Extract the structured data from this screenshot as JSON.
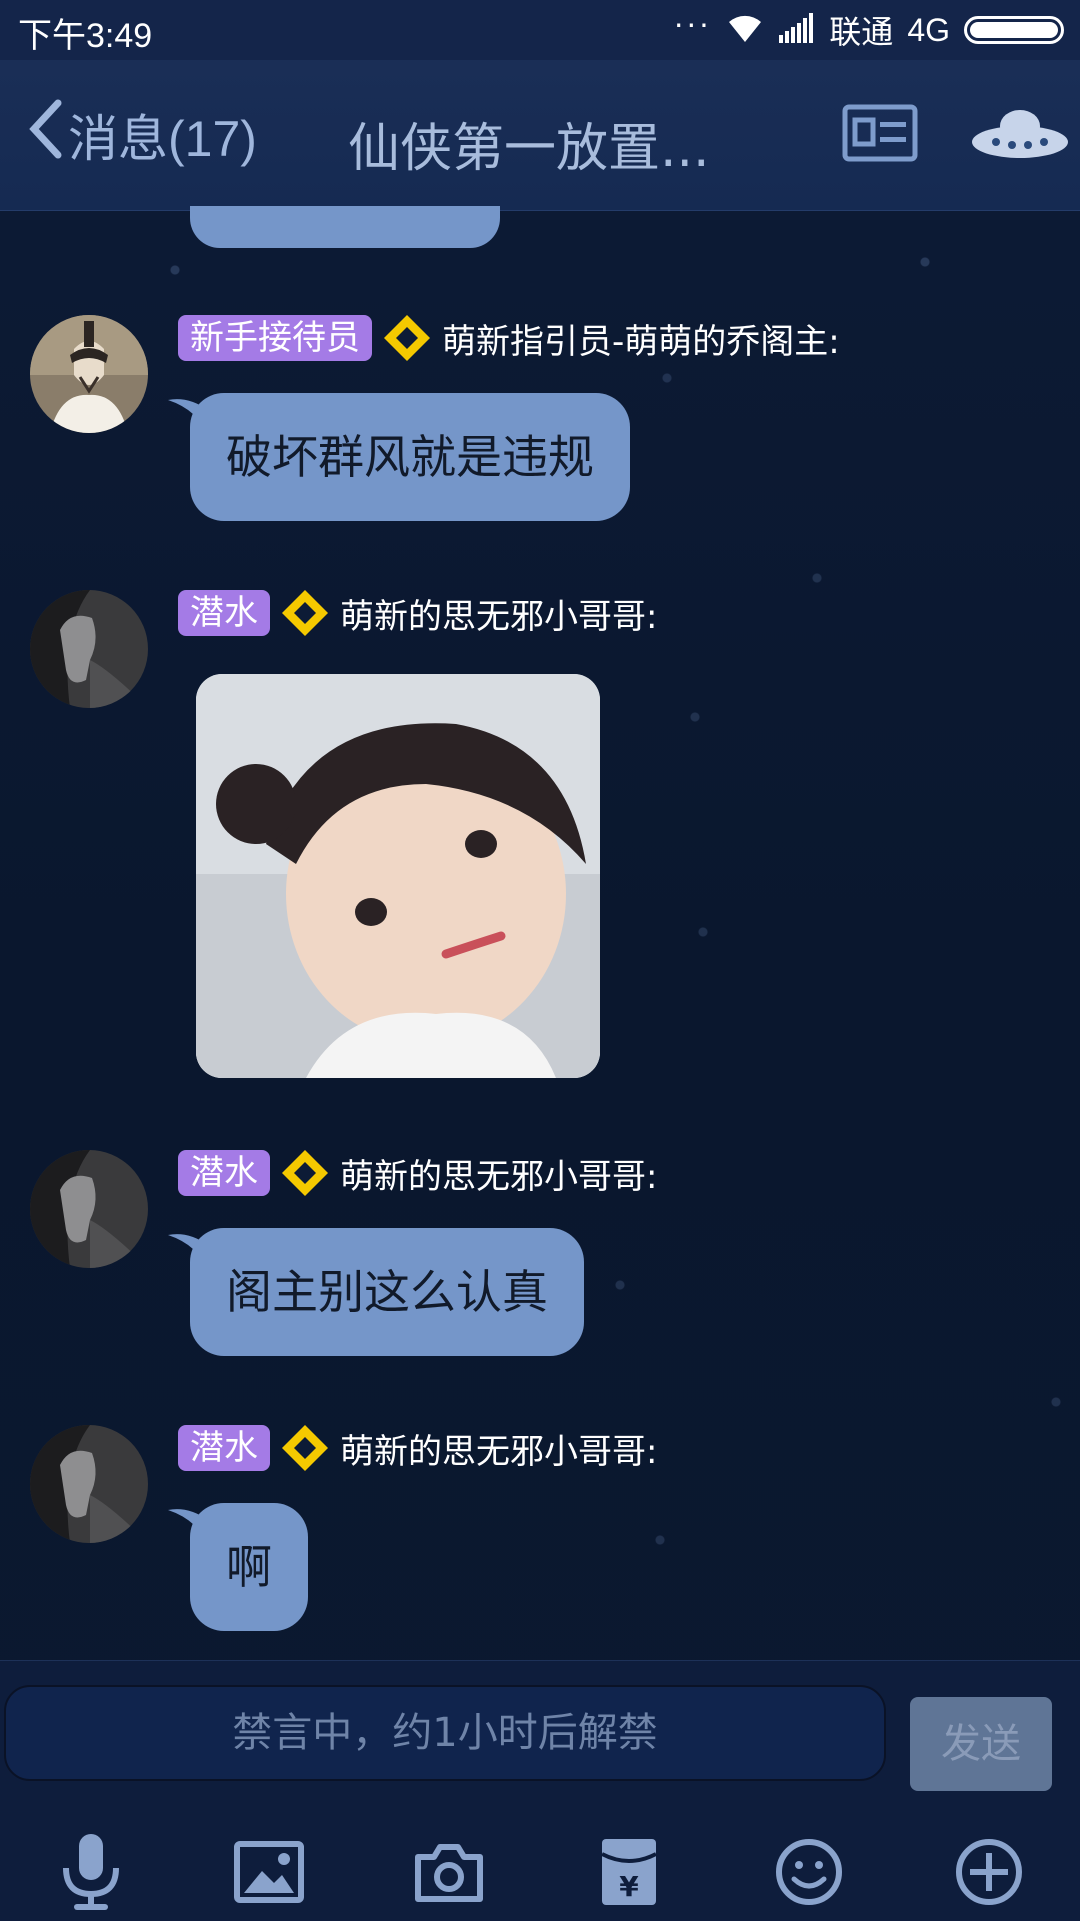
{
  "status_bar": {
    "time": "下午3:49",
    "carrier": "联通",
    "network": "4G"
  },
  "header": {
    "back_label": "消息(17)",
    "title": "仙侠第一放置..."
  },
  "messages": [
    {
      "badge": "新手接待员",
      "sender": "萌新指引员-萌萌的乔阁主:",
      "text": "破坏群风就是违规"
    },
    {
      "badge": "潜水",
      "sender": "萌新的思无邪小哥哥:",
      "type": "image"
    },
    {
      "badge": "潜水",
      "sender": "萌新的思无邪小哥哥:",
      "text": "阁主别这么认真"
    },
    {
      "badge": "潜水",
      "sender": "萌新的思无邪小哥哥:",
      "text": "啊"
    }
  ],
  "input": {
    "placeholder": "禁言中，约1小时后解禁",
    "send_label": "发送"
  },
  "colors": {
    "background": "#0b1830",
    "bubble": "#7596c9",
    "badge": "#a47be6",
    "diamond": "#f5c900"
  },
  "toolbar_icons": [
    "microphone-icon",
    "image-icon",
    "camera-icon",
    "red-packet-icon",
    "emoji-icon",
    "plus-icon"
  ]
}
